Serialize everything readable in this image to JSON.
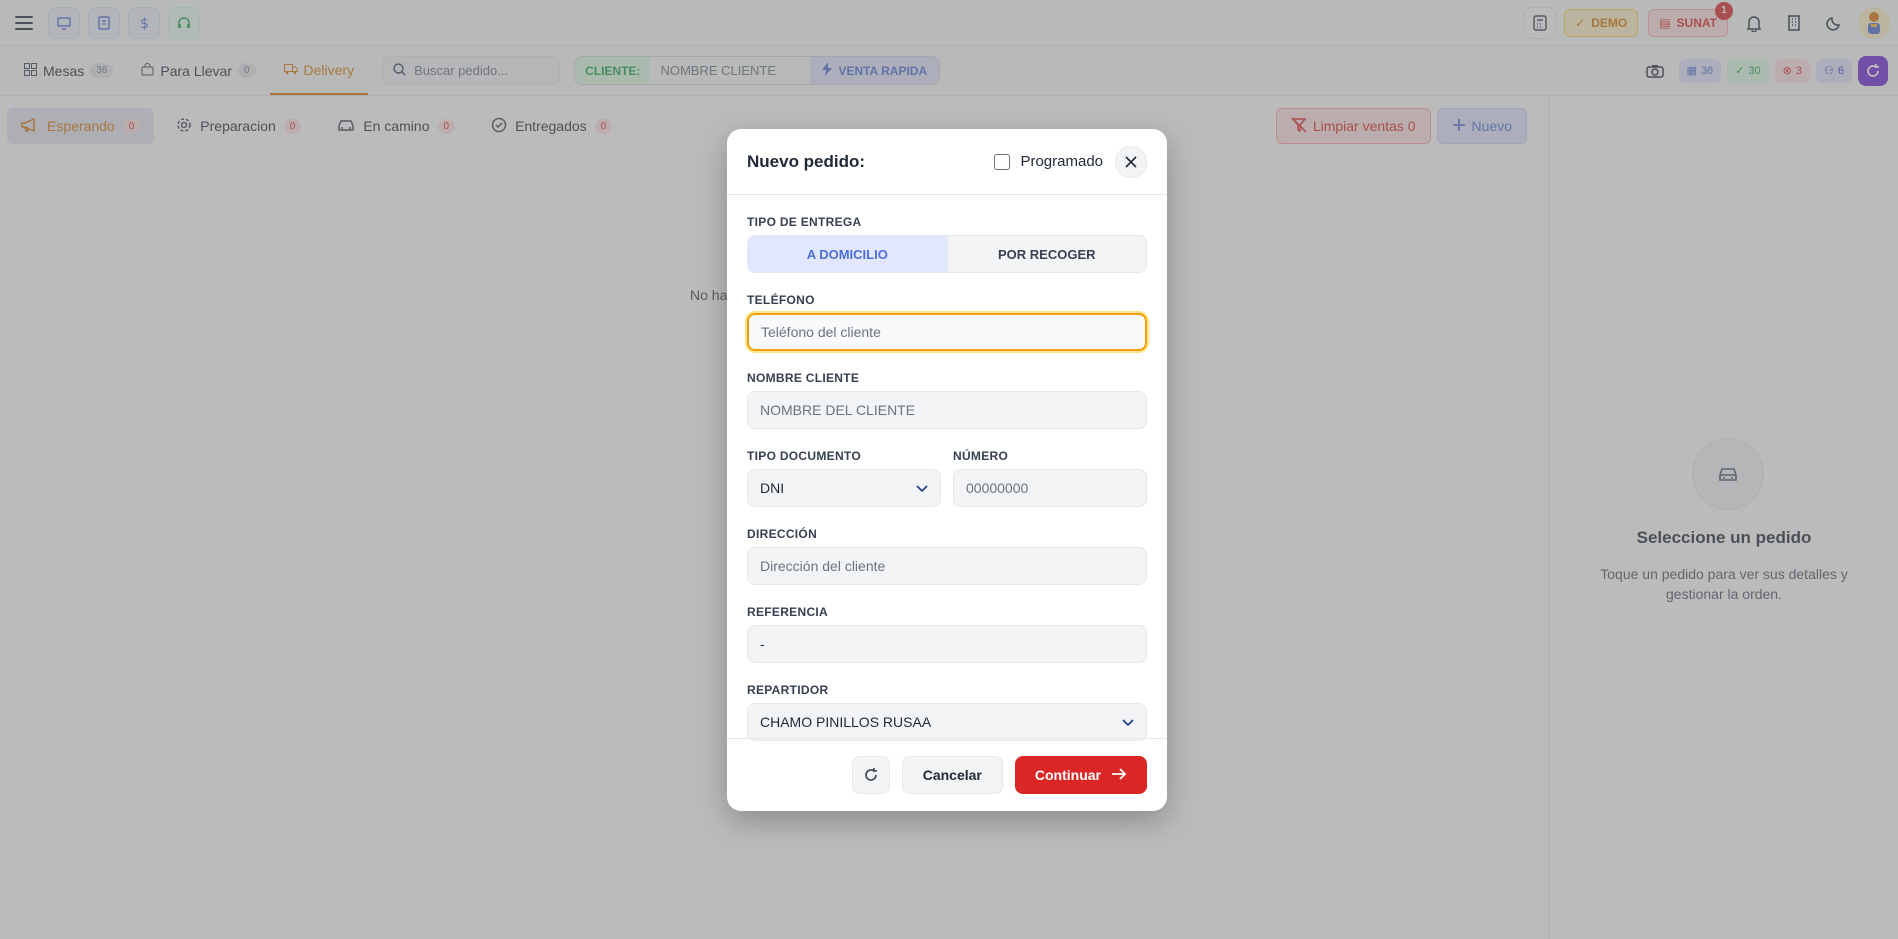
{
  "topbar": {
    "demo_label": "DEMO",
    "sunat_label": "SUNAT",
    "sunat_notifications": "1"
  },
  "tabs": [
    {
      "label": "Mesas",
      "count": "36"
    },
    {
      "label": "Para Llevar",
      "count": "0"
    },
    {
      "label": "Delivery",
      "count": ""
    }
  ],
  "search": {
    "placeholder": "Buscar pedido..."
  },
  "cliente": {
    "label": "CLIENTE:",
    "placeholder": "NOMBRE CLIENTE",
    "venta_rapida": "VENTA RAPIDA"
  },
  "stats": {
    "mesas": "36",
    "libres": "30",
    "ocupadas": "3",
    "usuarios": "6"
  },
  "status_tabs": [
    {
      "label": "Esperando",
      "count": "0"
    },
    {
      "label": "Preparacion",
      "count": "0"
    },
    {
      "label": "En camino",
      "count": "0"
    },
    {
      "label": "Entregados",
      "count": "0"
    }
  ],
  "actions": {
    "limpiar": "Limpiar ventas 0",
    "nuevo": "Nuevo"
  },
  "empty_text": "No ha",
  "detail": {
    "title": "Seleccione un pedido",
    "subtitle": "Toque un pedido para ver sus detalles y gestionar la orden."
  },
  "modal": {
    "title": "Nuevo pedido:",
    "programado": "Programado",
    "tipo_entrega_label": "TIPO DE ENTREGA",
    "tipo_entrega_options": [
      "A DOMICILIO",
      "POR RECOGER"
    ],
    "telefono_label": "TELÉFONO",
    "telefono_placeholder": "Teléfono del cliente",
    "nombre_label": "NOMBRE CLIENTE",
    "nombre_placeholder": "NOMBRE DEL CLIENTE",
    "tipo_doc_label": "TIPO DOCUMENTO",
    "tipo_doc_value": "DNI",
    "numero_label": "NÚMERO",
    "numero_placeholder": "00000000",
    "direccion_label": "DIRECCIÓN",
    "direccion_placeholder": "Dirección del cliente",
    "referencia_label": "REFERENCIA",
    "referencia_value": "-",
    "repartidor_label": "REPARTIDOR",
    "repartidor_value": "CHAMO PINILLOS RUSAA",
    "cancel": "Cancelar",
    "continue": "Continuar"
  }
}
